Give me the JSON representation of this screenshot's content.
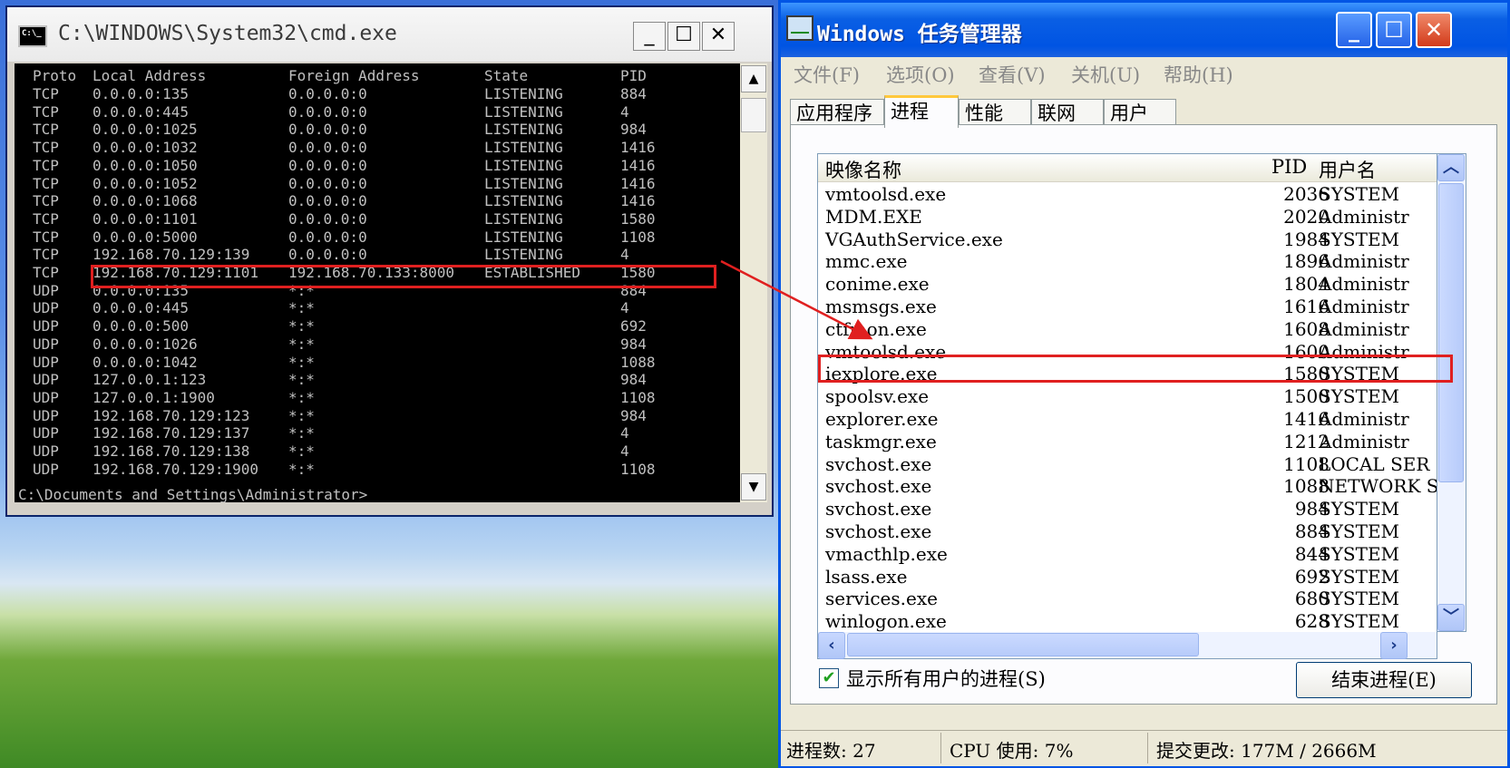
{
  "cmd": {
    "title": "C:\\WINDOWS\\System32\\cmd.exe",
    "icon_text": "C:\\_",
    "buttons": {
      "minimize": "_",
      "maximize": "☐",
      "close": "✕"
    },
    "header": {
      "proto": "Proto",
      "local": "Local Address",
      "foreign": "Foreign Address",
      "state": "State",
      "pid": "PID"
    },
    "rows": [
      {
        "proto": "TCP",
        "local": "0.0.0.0:135",
        "foreign": "0.0.0.0:0",
        "state": "LISTENING",
        "pid": "884"
      },
      {
        "proto": "TCP",
        "local": "0.0.0.0:445",
        "foreign": "0.0.0.0:0",
        "state": "LISTENING",
        "pid": "4"
      },
      {
        "proto": "TCP",
        "local": "0.0.0.0:1025",
        "foreign": "0.0.0.0:0",
        "state": "LISTENING",
        "pid": "984"
      },
      {
        "proto": "TCP",
        "local": "0.0.0.0:1032",
        "foreign": "0.0.0.0:0",
        "state": "LISTENING",
        "pid": "1416"
      },
      {
        "proto": "TCP",
        "local": "0.0.0.0:1050",
        "foreign": "0.0.0.0:0",
        "state": "LISTENING",
        "pid": "1416"
      },
      {
        "proto": "TCP",
        "local": "0.0.0.0:1052",
        "foreign": "0.0.0.0:0",
        "state": "LISTENING",
        "pid": "1416"
      },
      {
        "proto": "TCP",
        "local": "0.0.0.0:1068",
        "foreign": "0.0.0.0:0",
        "state": "LISTENING",
        "pid": "1416"
      },
      {
        "proto": "TCP",
        "local": "0.0.0.0:1101",
        "foreign": "0.0.0.0:0",
        "state": "LISTENING",
        "pid": "1580"
      },
      {
        "proto": "TCP",
        "local": "0.0.0.0:5000",
        "foreign": "0.0.0.0:0",
        "state": "LISTENING",
        "pid": "1108"
      },
      {
        "proto": "TCP",
        "local": "192.168.70.129:139",
        "foreign": "0.0.0.0:0",
        "state": "LISTENING",
        "pid": "4"
      },
      {
        "proto": "TCP",
        "local": "192.168.70.129:1101",
        "foreign": "192.168.70.133:8000",
        "state": "ESTABLISHED",
        "pid": "1580"
      },
      {
        "proto": "UDP",
        "local": "0.0.0.0:135",
        "foreign": "*:*",
        "state": "",
        "pid": "884"
      },
      {
        "proto": "UDP",
        "local": "0.0.0.0:445",
        "foreign": "*:*",
        "state": "",
        "pid": "4"
      },
      {
        "proto": "UDP",
        "local": "0.0.0.0:500",
        "foreign": "*:*",
        "state": "",
        "pid": "692"
      },
      {
        "proto": "UDP",
        "local": "0.0.0.0:1026",
        "foreign": "*:*",
        "state": "",
        "pid": "984"
      },
      {
        "proto": "UDP",
        "local": "0.0.0.0:1042",
        "foreign": "*:*",
        "state": "",
        "pid": "1088"
      },
      {
        "proto": "UDP",
        "local": "127.0.0.1:123",
        "foreign": "*:*",
        "state": "",
        "pid": "984"
      },
      {
        "proto": "UDP",
        "local": "127.0.0.1:1900",
        "foreign": "*:*",
        "state": "",
        "pid": "1108"
      },
      {
        "proto": "UDP",
        "local": "192.168.70.129:123",
        "foreign": "*:*",
        "state": "",
        "pid": "984"
      },
      {
        "proto": "UDP",
        "local": "192.168.70.129:137",
        "foreign": "*:*",
        "state": "",
        "pid": "4"
      },
      {
        "proto": "UDP",
        "local": "192.168.70.129:138",
        "foreign": "*:*",
        "state": "",
        "pid": "4"
      },
      {
        "proto": "UDP",
        "local": "192.168.70.129:1900",
        "foreign": "*:*",
        "state": "",
        "pid": "1108"
      }
    ],
    "highlight_row_index": 10,
    "prompt": "C:\\Documents and Settings\\Administrator>"
  },
  "taskmgr": {
    "title": "Windows 任务管理器",
    "buttons": {
      "minimize": "_",
      "maximize": "☐",
      "close": "✕"
    },
    "menu": [
      "文件(F)",
      "选项(O)",
      "查看(V)",
      "关机(U)",
      "帮助(H)"
    ],
    "tabs": [
      "应用程序",
      "进程",
      "性能",
      "联网",
      "用户"
    ],
    "active_tab": "进程",
    "columns": {
      "name": "映像名称",
      "pid": "PID",
      "user": "用户名"
    },
    "processes": [
      {
        "name": "vmtoolsd.exe",
        "pid": "2036",
        "user": "SYSTEM"
      },
      {
        "name": "MDM.EXE",
        "pid": "2020",
        "user": "Administr"
      },
      {
        "name": "VGAuthService.exe",
        "pid": "1984",
        "user": "SYSTEM"
      },
      {
        "name": "mmc.exe",
        "pid": "1896",
        "user": "Administr"
      },
      {
        "name": "conime.exe",
        "pid": "1804",
        "user": "Administr"
      },
      {
        "name": "msmsgs.exe",
        "pid": "1616",
        "user": "Administr"
      },
      {
        "name": "ctfmon.exe",
        "pid": "1608",
        "user": "Administr"
      },
      {
        "name": "vmtoolsd.exe",
        "pid": "1600",
        "user": "Administr"
      },
      {
        "name": "iexplore.exe",
        "pid": "1580",
        "user": "SYSTEM"
      },
      {
        "name": "spoolsv.exe",
        "pid": "1500",
        "user": "SYSTEM"
      },
      {
        "name": "explorer.exe",
        "pid": "1416",
        "user": "Administr"
      },
      {
        "name": "taskmgr.exe",
        "pid": "1212",
        "user": "Administr"
      },
      {
        "name": "svchost.exe",
        "pid": "1108",
        "user": "LOCAL SER"
      },
      {
        "name": "svchost.exe",
        "pid": "1088",
        "user": "NETWORK S"
      },
      {
        "name": "svchost.exe",
        "pid": "984",
        "user": "SYSTEM"
      },
      {
        "name": "svchost.exe",
        "pid": "884",
        "user": "SYSTEM"
      },
      {
        "name": "vmacthlp.exe",
        "pid": "844",
        "user": "SYSTEM"
      },
      {
        "name": "lsass.exe",
        "pid": "692",
        "user": "SYSTEM"
      },
      {
        "name": "services.exe",
        "pid": "680",
        "user": "SYSTEM"
      },
      {
        "name": "winlogon.exe",
        "pid": "628",
        "user": "SYSTEM"
      }
    ],
    "highlight_process_index": 8,
    "show_all_users_label": "显示所有用户的进程(S)",
    "show_all_users_checked": true,
    "end_process_button": "结束进程(E)",
    "status": {
      "process_count": "进程数: 27",
      "cpu": "CPU 使用: 7%",
      "commit": "提交更改: 177M / 2666M"
    }
  },
  "colors": {
    "highlight": "#e02020",
    "cmd_bg": "#000000",
    "cmd_text": "#c0c0c0",
    "xp_titlebar": "#0054e3"
  }
}
